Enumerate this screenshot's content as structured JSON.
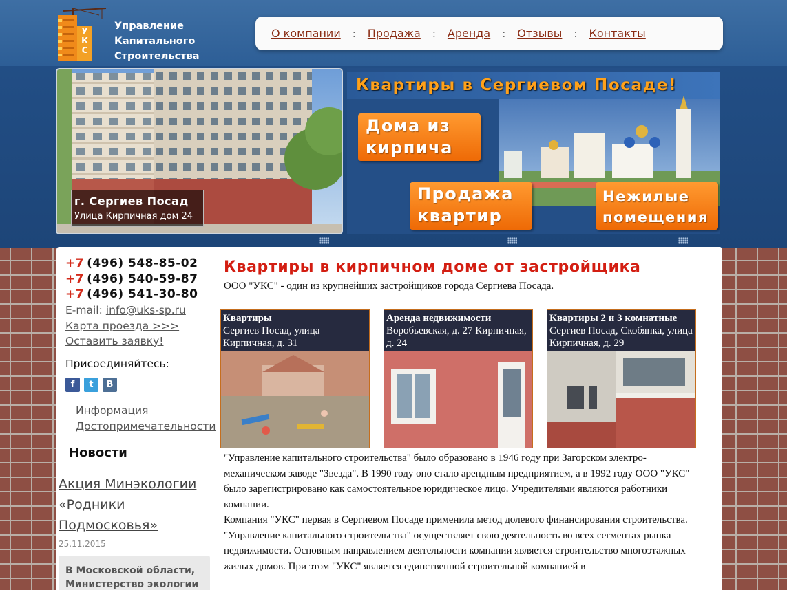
{
  "header": {
    "logo_text": "УКС",
    "brand_lines": [
      "Управление",
      "Капитального",
      "Строительства"
    ],
    "menu": [
      "О компании",
      "Продажа",
      "Аренда",
      "Отзывы",
      "Контакты"
    ],
    "menu_separator": ":"
  },
  "banner": {
    "photo_city": "г. Сергиев Посад",
    "photo_street": "Улица Кирпичная дом 24",
    "promo_title": "Квартиры в Сергиевом Посаде!",
    "btn_brick": "Дома из кирпича",
    "btn_sale": "Продажа квартир",
    "btn_nonres": "Нежилые помещения"
  },
  "sidebar": {
    "phones": [
      {
        "prefix": "+7",
        "number": "(496) 548-85-02"
      },
      {
        "prefix": "+7",
        "number": "(496) 540-59-87"
      },
      {
        "prefix": "+7",
        "number": "(496) 541-30-80"
      }
    ],
    "email_label": "E-mail:",
    "email": "info@uks-sp.ru",
    "map_link": "Карта проезда >>>",
    "request_link": "Оставить заявку!",
    "join_label": "Присоединяйтесь:",
    "social": [
      "f",
      "t",
      "B"
    ],
    "info_links": [
      "Информация",
      "Достопримечательности"
    ],
    "news_heading": "Новости",
    "news_item_title": "Акция Минэкологии «Родники Подмосковья»",
    "news_item_date": "25.11.2015",
    "news_item_preview": "В Московской области, Министерство экологии"
  },
  "main": {
    "heading": "Квартиры в кирпичном доме от застройщика",
    "intro": "ООО \"УКС\" - один из крупнейших застройщиков города Сергиева Посада.",
    "cards": [
      {
        "title": "Квартиры",
        "text": "Сергиев Посад, улица Кирпичная, д. 31"
      },
      {
        "title": "Аренда недвижимости",
        "text": "Воробьевская, д. 27 Кирпичная, д. 24"
      },
      {
        "title": "Квартиры 2 и 3 комнатные",
        "text": "Сергиев Посад, Скобянка, улица Кирпичная, д. 29"
      }
    ],
    "paragraphs": [
      "\"Управление капитального строительства\" было образовано в 1946 году при Загорском электро-механическом заводе \"Звезда\". В 1990 году оно стало арендным предприятием, а в 1992 году ООО \"УКС\" было зарегистрировано как самостоятельное юридическое лицо. Учредителями являются работники компании.",
      "Компания \"УКС\" первая в Сергиевом Посаде применила метод долевого финансирования строительства.",
      "\"Управление капитального строительства\" осуществляет свою деятельность во всех сегментах рынка недвижимости. Основным направлением деятельности компании является строительство многоэтажных жилых домов. При этом \"УКС\" является единственной строительной компанией в"
    ]
  }
}
